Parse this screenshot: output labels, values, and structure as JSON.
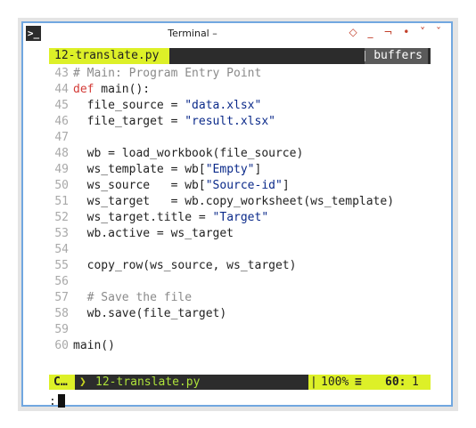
{
  "window": {
    "title": "Terminal –",
    "icon_glyph": ">_",
    "controls": [
      "◇",
      "_",
      "¬",
      "•",
      "˅",
      "ˇ"
    ]
  },
  "tabbar": {
    "active_tab": "12-translate.py",
    "buffers_label": "buffers"
  },
  "code_lines": [
    {
      "n": "43",
      "text": "# Main: Program Entry Point"
    },
    {
      "n": "44",
      "kw": "def",
      "text": " main():"
    },
    {
      "n": "45",
      "pre": "  file_source = ",
      "str": "\"data.xlsx\""
    },
    {
      "n": "46",
      "pre": "  file_target = ",
      "str": "\"result.xlsx\""
    },
    {
      "n": "47",
      "text": ""
    },
    {
      "n": "48",
      "text": "  wb = load_workbook(file_source)"
    },
    {
      "n": "49",
      "pre": "  ws_template = wb[",
      "str": "\"Empty\"",
      "post": "]"
    },
    {
      "n": "50",
      "pre": "  ws_source   = wb[",
      "str": "\"Source-id\"",
      "post": "]"
    },
    {
      "n": "51",
      "text": "  ws_target   = wb.copy_worksheet(ws_template)"
    },
    {
      "n": "52",
      "pre": "  ws_target.title = ",
      "str": "\"Target\""
    },
    {
      "n": "53",
      "text": "  wb.active = ws_target"
    },
    {
      "n": "54",
      "text": ""
    },
    {
      "n": "55",
      "text": "  copy_row(ws_source, ws_target)"
    },
    {
      "n": "56",
      "text": ""
    },
    {
      "n": "57",
      "text": "  # Save the file"
    },
    {
      "n": "58",
      "text": "  wb.save(file_target)"
    },
    {
      "n": "59",
      "text": ""
    },
    {
      "n": "60",
      "text": "main()"
    }
  ],
  "statusbar": {
    "mode": "C…",
    "file_arrow": "❯",
    "filename": "12-translate.py",
    "right_arrow": "❮",
    "pipe": "|",
    "zoom": "100%",
    "eq_icon": "≡",
    "position": "60:",
    "column": "1"
  },
  "cmdline": {
    "prompt": ":"
  },
  "colors": {
    "accent": "#ddf028",
    "bar_bg": "#2c2c2c",
    "window_border": "#71a7e0",
    "string": "#0b2a8a",
    "keyword": "#d33b37",
    "line_number": "#a9a9a9"
  }
}
